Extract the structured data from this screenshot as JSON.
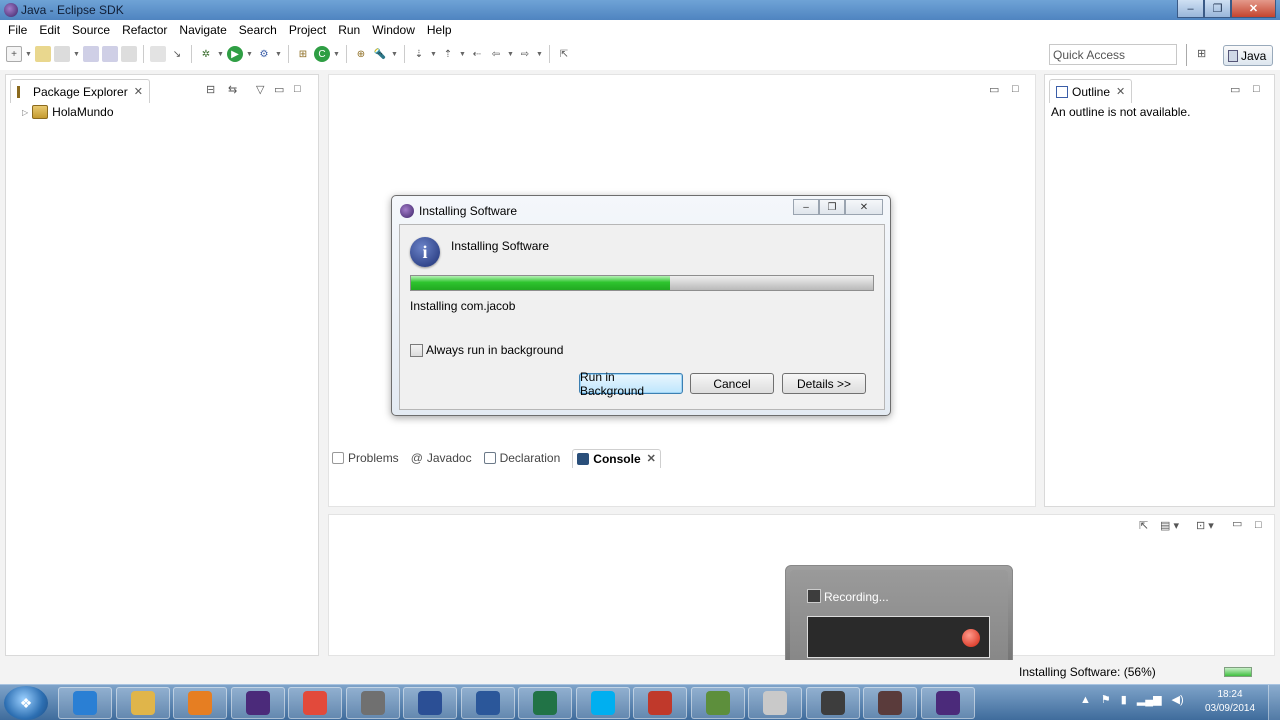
{
  "window": {
    "title": "Java - Eclipse SDK",
    "minimize": "‒",
    "maximize": "❐",
    "close": "✕"
  },
  "menu": [
    "File",
    "Edit",
    "Source",
    "Refactor",
    "Navigate",
    "Search",
    "Project",
    "Run",
    "Window",
    "Help"
  ],
  "toolbar": {
    "quick_access_placeholder": "Quick Access",
    "perspective_label": "Java"
  },
  "package_explorer": {
    "tab_label": "Package Explorer",
    "project": "HolaMundo"
  },
  "outline": {
    "tab_label": "Outline",
    "message": "An outline is not available."
  },
  "bottom_tabs": [
    "Problems",
    "Javadoc",
    "Declaration",
    "Console"
  ],
  "dialog": {
    "title": "Installing Software",
    "heading": "Installing Software",
    "progress": 0.56,
    "status": "Installing com.jacob",
    "checkbox_label": "Always run in background",
    "buttons": {
      "run_bg": "Run in Background",
      "cancel": "Cancel",
      "details": "Details >>"
    }
  },
  "recorder": {
    "label": "Recording..."
  },
  "statusbar": {
    "progress_text": "Installing Software: (56%)"
  },
  "taskbar": {
    "time": "18:24",
    "date": "03/09/2014",
    "apps": [
      {
        "name": "ie-icon",
        "color": "#2a7fd4"
      },
      {
        "name": "explorer-icon",
        "color": "#e0b54a"
      },
      {
        "name": "media-player-icon",
        "color": "#e67e22"
      },
      {
        "name": "eclipse-icon",
        "color": "#4b2a7a"
      },
      {
        "name": "chrome-icon",
        "color": "#e24a3b"
      },
      {
        "name": "settings-icon",
        "color": "#707070"
      },
      {
        "name": "writer-icon",
        "color": "#2b4f95"
      },
      {
        "name": "word-icon",
        "color": "#2b579a"
      },
      {
        "name": "excel-icon",
        "color": "#217346"
      },
      {
        "name": "skype-icon",
        "color": "#00aff0"
      },
      {
        "name": "paint-icon",
        "color": "#c0392b"
      },
      {
        "name": "image-viewer-icon",
        "color": "#5d8f3c"
      },
      {
        "name": "notepad-icon",
        "color": "#c9c9c9"
      },
      {
        "name": "recorder-app-icon",
        "color": "#3d3d3d"
      },
      {
        "name": "recorder-app-2-icon",
        "color": "#5a3b3b"
      },
      {
        "name": "eclipse-2-icon",
        "color": "#4b2a7a"
      }
    ]
  }
}
